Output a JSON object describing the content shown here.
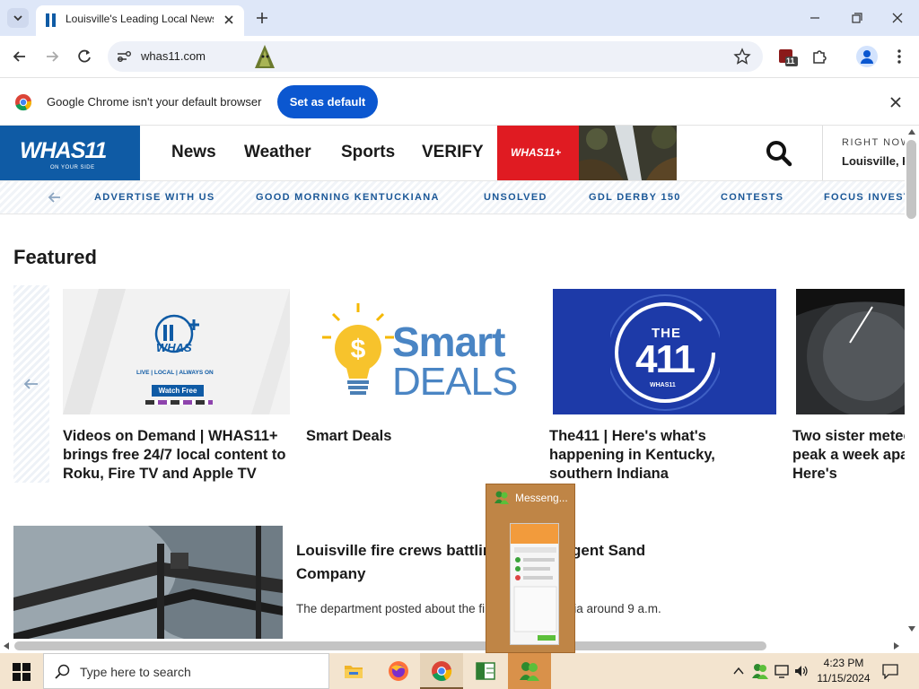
{
  "browser": {
    "tab_title": "Louisville's Leading Local News",
    "url": "whas11.com",
    "extension_badge": "11"
  },
  "infobar": {
    "message": "Google Chrome isn't your default browser",
    "button_label": "Set as default"
  },
  "site": {
    "logo_text": "WHAS11",
    "logo_sub": "ON YOUR SIDE",
    "nav": [
      "News",
      "Weather",
      "Sports",
      "VERIFY"
    ],
    "plus_label": "WHAS11+",
    "weather_heading": "RIGHT NOW",
    "weather_location": "Louisville, KY",
    "subnav": [
      "ADVERTISE WITH US",
      "GOOD MORNING KENTUCKIANA",
      "UNSOLVED",
      "GDL DERBY 150",
      "CONTESTS",
      "FOCUS INVESTIGATES"
    ],
    "featured_heading": "Featured",
    "cards": [
      {
        "title": "Videos on Demand | WHAS11+ brings free 24/7 local content to Roku, Fire TV and Apple TV",
        "img_text": "WHAS",
        "img_tag": "LIVE | LOCAL | ALWAYS ON",
        "img_button": "Watch Free"
      },
      {
        "title": "Smart Deals",
        "img_line1": "Smart",
        "img_line2": "DEALS"
      },
      {
        "title": "The411 | Here's what's happening in Kentucky, southern Indiana",
        "img_line1": "THE",
        "img_line2": "411",
        "img_line3": "WHAS11"
      },
      {
        "title": "Two sister meteor showers peak a week apart in November. Here's"
      }
    ],
    "story": {
      "title": "Louisville fire crews battling fire at Nugent Sand Company",
      "desc": "The department posted about the fire on social media around 9 a.m."
    }
  },
  "taskbar": {
    "search_placeholder": "Type here to search",
    "time": "4:23 PM",
    "date": "11/15/2024",
    "popup_title": "Messeng..."
  },
  "colors": {
    "brand_blue": "#0f5ba5",
    "plus_red": "#e01b22",
    "chrome_blue": "#0b57d0",
    "taskbar": "#f3e4cf",
    "popup": "#bf8546"
  }
}
